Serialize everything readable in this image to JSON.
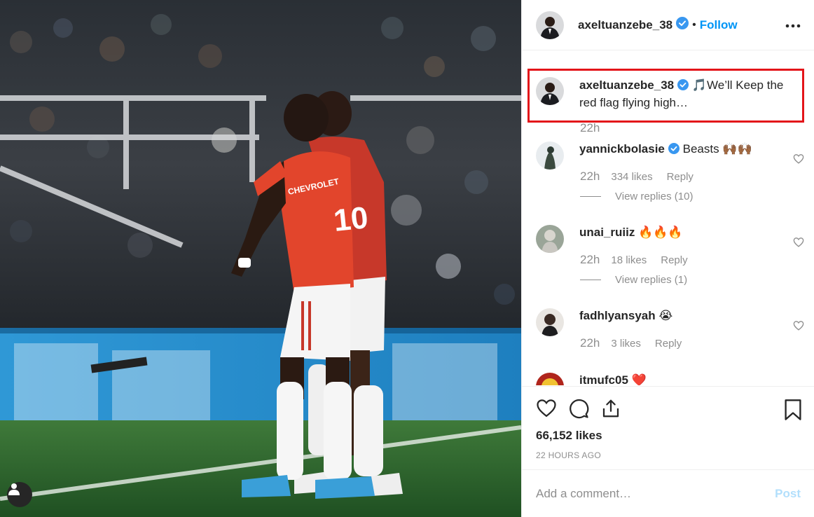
{
  "post": {
    "username": "axeltuanzebe_38",
    "follow_label": "Follow",
    "separator": "•",
    "caption_text": "🎵We’ll Keep the red flag flying high…",
    "caption_time": "22h",
    "likes": "66,152 likes",
    "time_ago": "22 HOURS AGO"
  },
  "comments": [
    {
      "username": "yannickbolasie",
      "text": "Beasts 🙌🏾🙌🏾",
      "time": "22h",
      "likes": "334 likes",
      "reply": "Reply",
      "view_replies": "View replies (10)",
      "verified": true
    },
    {
      "username": "unai_ruiiz",
      "text": "🔥🔥🔥",
      "time": "22h",
      "likes": "18 likes",
      "reply": "Reply",
      "view_replies": "View replies (1)",
      "verified": false
    },
    {
      "username": "fadhlyansyah",
      "text": "😭",
      "time": "22h",
      "likes": "3 likes",
      "reply": "Reply",
      "verified": false
    },
    {
      "username": "itmufc05",
      "text": "❤️",
      "verified": false
    }
  ],
  "add_comment": {
    "placeholder": "Add a comment…",
    "post_label": "Post"
  },
  "photo": {
    "jersey_number": "10",
    "sponsor": "CHEVROLET"
  },
  "colors": {
    "accent": "#0095f6",
    "highlight": "#e3151a",
    "kit_red": "#e2452c",
    "post_disabled": "#b2dffc"
  }
}
